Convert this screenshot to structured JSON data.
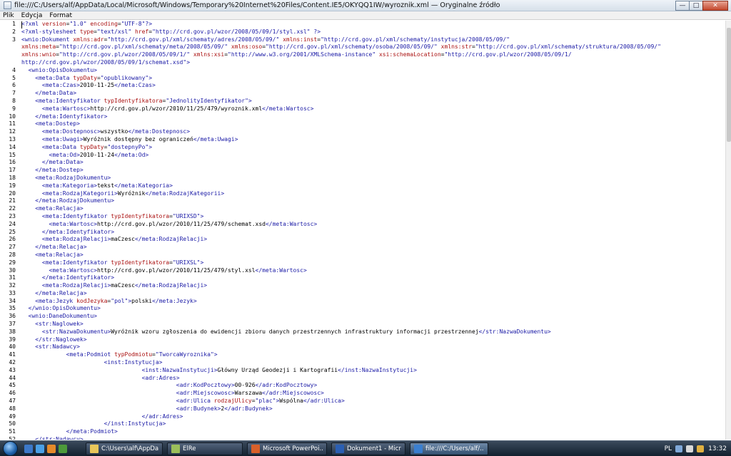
{
  "window": {
    "title": "file:///C:/Users/alf/AppData/Local/Microsoft/Windows/Temporary%20Internet%20Files/Content.IE5/OKYQQ1IW/wyroznik.xml — Oryginalne źródło",
    "minimize_symbol": "—",
    "maximize_symbol": "□",
    "close_symbol": "✕"
  },
  "menu": [
    "Plik",
    "Edycja",
    "Format"
  ],
  "editor": {
    "lines": [
      {
        "n": "1",
        "parts": [
          [
            "t-b",
            "<?xml "
          ],
          [
            "t-r",
            "version"
          ],
          [
            "t-k",
            "="
          ],
          [
            "t-b",
            "\"1.0\" "
          ],
          [
            "t-r",
            "encoding"
          ],
          [
            "t-k",
            "="
          ],
          [
            "t-b",
            "\"UTF-8\"?>"
          ]
        ]
      },
      {
        "n": "2",
        "parts": [
          [
            "t-b",
            "<?xml-stylesheet "
          ],
          [
            "t-r",
            "type"
          ],
          [
            "t-k",
            "="
          ],
          [
            "t-b",
            "\"text/xsl\" "
          ],
          [
            "t-r",
            "href"
          ],
          [
            "t-k",
            "="
          ],
          [
            "t-b",
            "\"http://crd.gov.pl/wzor/2008/05/09/1/styl.xsl\" ?>"
          ]
        ]
      },
      {
        "n": "3",
        "parts": [
          [
            "t-b",
            "<wnio:Dokument "
          ],
          [
            "t-r",
            "xmlns:adr"
          ],
          [
            "t-k",
            "="
          ],
          [
            "t-b",
            "\"http://crd.gov.pl/xml/schematy/adres/2008/05/09/\" "
          ],
          [
            "t-r",
            "xmlns:inst"
          ],
          [
            "t-k",
            "="
          ],
          [
            "t-b",
            "\"http://crd.gov.pl/xml/schematy/instytucja/2008/05/09/\""
          ]
        ]
      },
      {
        "n": "",
        "parts": [
          [
            "t-r",
            "xmlns:meta"
          ],
          [
            "t-k",
            "="
          ],
          [
            "t-b",
            "\"http://crd.gov.pl/xml/schematy/meta/2008/05/09/\" "
          ],
          [
            "t-r",
            "xmlns:oso"
          ],
          [
            "t-k",
            "="
          ],
          [
            "t-b",
            "\"http://crd.gov.pl/xml/schematy/osoba/2008/05/09/\" "
          ],
          [
            "t-r",
            "xmlns:str"
          ],
          [
            "t-k",
            "="
          ],
          [
            "t-b",
            "\"http://crd.gov.pl/xml/schematy/struktura/2008/05/09/\""
          ]
        ]
      },
      {
        "n": "",
        "parts": [
          [
            "t-r",
            "xmlns:wnio"
          ],
          [
            "t-k",
            "="
          ],
          [
            "t-b",
            "\"http://crd.gov.pl/wzor/2008/05/09/1/\" "
          ],
          [
            "t-r",
            "xmlns:xsi"
          ],
          [
            "t-k",
            "="
          ],
          [
            "t-b",
            "\"http://www.w3.org/2001/XMLSchema-instance\" "
          ],
          [
            "t-r",
            "xsi:schemaLocation"
          ],
          [
            "t-k",
            "="
          ],
          [
            "t-b",
            "\"http://crd.gov.pl/wzor/2008/05/09/1/"
          ]
        ]
      },
      {
        "n": "",
        "parts": [
          [
            "t-b",
            "http://crd.gov.pl/wzor/2008/05/09/1/schemat.xsd\">"
          ]
        ]
      },
      {
        "n": "4",
        "parts": [
          [
            "t-k",
            "  "
          ],
          [
            "t-b",
            "<wnio:OpisDokumentu>"
          ]
        ]
      },
      {
        "n": "5",
        "parts": [
          [
            "t-k",
            "    "
          ],
          [
            "t-b",
            "<meta:Data "
          ],
          [
            "t-r",
            "typDaty"
          ],
          [
            "t-k",
            "="
          ],
          [
            "t-b",
            "\"opublikowany\">"
          ]
        ]
      },
      {
        "n": "6",
        "parts": [
          [
            "t-k",
            "      "
          ],
          [
            "t-b",
            "<meta:Czas>"
          ],
          [
            "t-k",
            "2010-11-25"
          ],
          [
            "t-b",
            "</meta:Czas>"
          ]
        ]
      },
      {
        "n": "7",
        "parts": [
          [
            "t-k",
            "    "
          ],
          [
            "t-b",
            "</meta:Data>"
          ]
        ]
      },
      {
        "n": "8",
        "parts": [
          [
            "t-k",
            "    "
          ],
          [
            "t-b",
            "<meta:Identyfikator "
          ],
          [
            "t-r",
            "typIdentyfikatora"
          ],
          [
            "t-k",
            "="
          ],
          [
            "t-b",
            "\"JednolityIdentyfikator\">"
          ]
        ]
      },
      {
        "n": "9",
        "parts": [
          [
            "t-k",
            "      "
          ],
          [
            "t-b",
            "<meta:Wartosc>"
          ],
          [
            "t-k",
            "http://crd.gov.pl/wzor/2010/11/25/479/wyroznik.xml"
          ],
          [
            "t-b",
            "</meta:Wartosc>"
          ]
        ]
      },
      {
        "n": "10",
        "parts": [
          [
            "t-k",
            "    "
          ],
          [
            "t-b",
            "</meta:Identyfikator>"
          ]
        ]
      },
      {
        "n": "11",
        "parts": [
          [
            "t-k",
            "    "
          ],
          [
            "t-b",
            "<meta:Dostep>"
          ]
        ]
      },
      {
        "n": "12",
        "parts": [
          [
            "t-k",
            "      "
          ],
          [
            "t-b",
            "<meta:Dostepnosc>"
          ],
          [
            "t-k",
            "wszystko"
          ],
          [
            "t-b",
            "</meta:Dostepnosc>"
          ]
        ]
      },
      {
        "n": "13",
        "parts": [
          [
            "t-k",
            "      "
          ],
          [
            "t-b",
            "<meta:Uwagi>"
          ],
          [
            "t-k",
            "Wyróżnik dostępny bez ograniczeń"
          ],
          [
            "t-b",
            "</meta:Uwagi>"
          ]
        ]
      },
      {
        "n": "14",
        "parts": [
          [
            "t-k",
            "      "
          ],
          [
            "t-b",
            "<meta:Data "
          ],
          [
            "t-r",
            "typDaty"
          ],
          [
            "t-k",
            "="
          ],
          [
            "t-b",
            "\"dostepnyPo\">"
          ]
        ]
      },
      {
        "n": "15",
        "parts": [
          [
            "t-k",
            "        "
          ],
          [
            "t-b",
            "<meta:Od>"
          ],
          [
            "t-k",
            "2010-11-24"
          ],
          [
            "t-b",
            "</meta:Od>"
          ]
        ]
      },
      {
        "n": "16",
        "parts": [
          [
            "t-k",
            "      "
          ],
          [
            "t-b",
            "</meta:Data>"
          ]
        ]
      },
      {
        "n": "17",
        "parts": [
          [
            "t-k",
            "    "
          ],
          [
            "t-b",
            "</meta:Dostep>"
          ]
        ]
      },
      {
        "n": "18",
        "parts": [
          [
            "t-k",
            "    "
          ],
          [
            "t-b",
            "<meta:RodzajDokumentu>"
          ]
        ]
      },
      {
        "n": "19",
        "parts": [
          [
            "t-k",
            "      "
          ],
          [
            "t-b",
            "<meta:Kategoria>"
          ],
          [
            "t-k",
            "tekst"
          ],
          [
            "t-b",
            "</meta:Kategoria>"
          ]
        ]
      },
      {
        "n": "20",
        "parts": [
          [
            "t-k",
            "      "
          ],
          [
            "t-b",
            "<meta:RodzajKategorii>"
          ],
          [
            "t-k",
            "Wyróżnik"
          ],
          [
            "t-b",
            "</meta:RodzajKategorii>"
          ]
        ]
      },
      {
        "n": "21",
        "parts": [
          [
            "t-k",
            "    "
          ],
          [
            "t-b",
            "</meta:RodzajDokumentu>"
          ]
        ]
      },
      {
        "n": "22",
        "parts": [
          [
            "t-k",
            "    "
          ],
          [
            "t-b",
            "<meta:Relacja>"
          ]
        ]
      },
      {
        "n": "23",
        "parts": [
          [
            "t-k",
            "      "
          ],
          [
            "t-b",
            "<meta:Identyfikator "
          ],
          [
            "t-r",
            "typIdentyfikatora"
          ],
          [
            "t-k",
            "="
          ],
          [
            "t-b",
            "\"URIXSD\">"
          ]
        ]
      },
      {
        "n": "24",
        "parts": [
          [
            "t-k",
            "        "
          ],
          [
            "t-b",
            "<meta:Wartosc>"
          ],
          [
            "t-k",
            "http://crd.gov.pl/wzor/2010/11/25/479/schemat.xsd"
          ],
          [
            "t-b",
            "</meta:Wartosc>"
          ]
        ]
      },
      {
        "n": "25",
        "parts": [
          [
            "t-k",
            "      "
          ],
          [
            "t-b",
            "</meta:Identyfikator>"
          ]
        ]
      },
      {
        "n": "26",
        "parts": [
          [
            "t-k",
            "      "
          ],
          [
            "t-b",
            "<meta:RodzajRelacji>"
          ],
          [
            "t-k",
            "maCzesc"
          ],
          [
            "t-b",
            "</meta:RodzajRelacji>"
          ]
        ]
      },
      {
        "n": "27",
        "parts": [
          [
            "t-k",
            "    "
          ],
          [
            "t-b",
            "</meta:Relacja>"
          ]
        ]
      },
      {
        "n": "28",
        "parts": [
          [
            "t-k",
            "    "
          ],
          [
            "t-b",
            "<meta:Relacja>"
          ]
        ]
      },
      {
        "n": "29",
        "parts": [
          [
            "t-k",
            "      "
          ],
          [
            "t-b",
            "<meta:Identyfikator "
          ],
          [
            "t-r",
            "typIdentyfikatora"
          ],
          [
            "t-k",
            "="
          ],
          [
            "t-b",
            "\"URIXSL\">"
          ]
        ]
      },
      {
        "n": "30",
        "parts": [
          [
            "t-k",
            "        "
          ],
          [
            "t-b",
            "<meta:Wartosc>"
          ],
          [
            "t-k",
            "http://crd.gov.pl/wzor/2010/11/25/479/styl.xsl"
          ],
          [
            "t-b",
            "</meta:Wartosc>"
          ]
        ]
      },
      {
        "n": "31",
        "parts": [
          [
            "t-k",
            "      "
          ],
          [
            "t-b",
            "</meta:Identyfikator>"
          ]
        ]
      },
      {
        "n": "32",
        "parts": [
          [
            "t-k",
            "      "
          ],
          [
            "t-b",
            "<meta:RodzajRelacji>"
          ],
          [
            "t-k",
            "maCzesc"
          ],
          [
            "t-b",
            "</meta:RodzajRelacji>"
          ]
        ]
      },
      {
        "n": "33",
        "parts": [
          [
            "t-k",
            "    "
          ],
          [
            "t-b",
            "</meta:Relacja>"
          ]
        ]
      },
      {
        "n": "34",
        "parts": [
          [
            "t-k",
            "    "
          ],
          [
            "t-b",
            "<meta:Jezyk "
          ],
          [
            "t-r",
            "kodJezyka"
          ],
          [
            "t-k",
            "="
          ],
          [
            "t-b",
            "\"pol\">"
          ],
          [
            "t-k",
            "polski"
          ],
          [
            "t-b",
            "</meta:Jezyk>"
          ]
        ]
      },
      {
        "n": "35",
        "parts": [
          [
            "t-k",
            "  "
          ],
          [
            "t-b",
            "</wnio:OpisDokumentu>"
          ]
        ]
      },
      {
        "n": "36",
        "parts": [
          [
            "t-k",
            "  "
          ],
          [
            "t-b",
            "<wnio:DaneDokumentu>"
          ]
        ]
      },
      {
        "n": "37",
        "parts": [
          [
            "t-k",
            "    "
          ],
          [
            "t-b",
            "<str:Naglowek>"
          ]
        ]
      },
      {
        "n": "38",
        "parts": [
          [
            "t-k",
            "      "
          ],
          [
            "t-b",
            "<str:NazwaDokumentu>"
          ],
          [
            "t-k",
            "Wyróżnik wzoru zgłoszenia do ewidencji zbioru danych przestrzennych infrastruktury informacji przestrzennej"
          ],
          [
            "t-b",
            "</str:NazwaDokumentu>"
          ]
        ]
      },
      {
        "n": "39",
        "parts": [
          [
            "t-k",
            "    "
          ],
          [
            "t-b",
            "</str:Naglowek>"
          ]
        ]
      },
      {
        "n": "40",
        "parts": [
          [
            "t-k",
            "    "
          ],
          [
            "t-b",
            "<str:Nadawcy>"
          ]
        ]
      },
      {
        "n": "41",
        "parts": [
          [
            "t-k",
            "             "
          ],
          [
            "t-b",
            "<meta:Podmiot "
          ],
          [
            "t-r",
            "typPodmiotu"
          ],
          [
            "t-k",
            "="
          ],
          [
            "t-b",
            "\"TworcaWyroznika\">"
          ]
        ]
      },
      {
        "n": "42",
        "parts": [
          [
            "t-k",
            "                        "
          ],
          [
            "t-b",
            "<inst:Instytucja>"
          ]
        ]
      },
      {
        "n": "43",
        "parts": [
          [
            "t-k",
            "                                   "
          ],
          [
            "t-b",
            "<inst:NazwaInstytucji>"
          ],
          [
            "t-k",
            "Główny Urząd Geodezji i Kartografii"
          ],
          [
            "t-b",
            "</inst:NazwaInstytucji>"
          ]
        ]
      },
      {
        "n": "44",
        "parts": [
          [
            "t-k",
            "                                   "
          ],
          [
            "t-b",
            "<adr:Adres>"
          ]
        ]
      },
      {
        "n": "45",
        "parts": [
          [
            "t-k",
            "                                             "
          ],
          [
            "t-b",
            "<adr:KodPocztowy>"
          ],
          [
            "t-k",
            "00-926"
          ],
          [
            "t-b",
            "</adr:KodPocztowy>"
          ]
        ]
      },
      {
        "n": "46",
        "parts": [
          [
            "t-k",
            "                                             "
          ],
          [
            "t-b",
            "<adr:Miejscowosc>"
          ],
          [
            "t-k",
            "Warszawa"
          ],
          [
            "t-b",
            "</adr:Miejscowosc>"
          ]
        ]
      },
      {
        "n": "47",
        "parts": [
          [
            "t-k",
            "                                             "
          ],
          [
            "t-b",
            "<adr:Ulica "
          ],
          [
            "t-r",
            "rodzajUlicy"
          ],
          [
            "t-k",
            "="
          ],
          [
            "t-b",
            "\"plac\">"
          ],
          [
            "t-k",
            "Wspólna"
          ],
          [
            "t-b",
            "</adr:Ulica>"
          ]
        ]
      },
      {
        "n": "48",
        "parts": [
          [
            "t-k",
            "                                             "
          ],
          [
            "t-b",
            "<adr:Budynek>"
          ],
          [
            "t-k",
            "2"
          ],
          [
            "t-b",
            "</adr:Budynek>"
          ]
        ]
      },
      {
        "n": "49",
        "parts": [
          [
            "t-k",
            "                                   "
          ],
          [
            "t-b",
            "</adr:Adres>"
          ]
        ]
      },
      {
        "n": "50",
        "parts": [
          [
            "t-k",
            "                        "
          ],
          [
            "t-b",
            "</inst:Instytucja>"
          ]
        ]
      },
      {
        "n": "51",
        "parts": [
          [
            "t-k",
            "             "
          ],
          [
            "t-b",
            "</meta:Podmiot>"
          ]
        ]
      },
      {
        "n": "52",
        "parts": [
          [
            "t-k",
            "    "
          ],
          [
            "t-b",
            "</str:Nadawcy>"
          ]
        ]
      }
    ]
  },
  "taskbar": {
    "tasks": [
      {
        "label": "C:\\Users\\alf\\AppDat...",
        "icon_color": "#e8c65a",
        "active": false
      },
      {
        "label": "ElRe",
        "icon_color": "#9bbf5a",
        "active": false
      },
      {
        "label": "Microsoft PowerPoi...",
        "icon_color": "#d8602a",
        "active": false
      },
      {
        "label": "Dokument1 - Micro...",
        "icon_color": "#2b5fb3",
        "active": false
      },
      {
        "label": "file:///C:/Users/alf/...",
        "icon_color": "#3a7fd0",
        "active": true
      }
    ],
    "language": "PL",
    "clock": "13:32"
  }
}
